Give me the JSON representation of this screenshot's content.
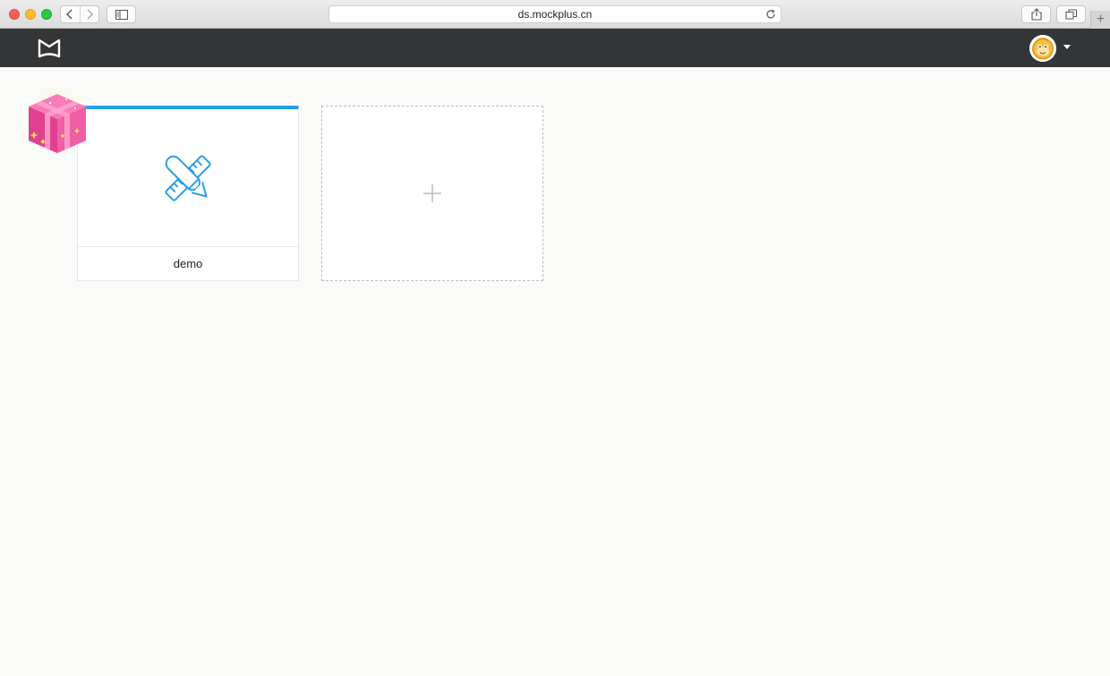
{
  "browser": {
    "url": "ds.mockplus.cn",
    "icons": {
      "back": "chevron-left-icon",
      "forward": "chevron-right-icon",
      "sidebar": "sidebar-icon",
      "reload": "reload-icon",
      "share": "share-icon",
      "tabs": "tabs-overview-icon",
      "new_tab": "plus-icon"
    },
    "new_tab_glyph": "+"
  },
  "header": {
    "logo": "mockplus-logo",
    "avatar": "monkey-avatar",
    "menu_icon": "caret-down-icon"
  },
  "projects": [
    {
      "name": "demo",
      "icon": "ruler-pencil-icon"
    }
  ],
  "add_project": {
    "icon": "plus-icon"
  },
  "promo": {
    "icon": "gift-box-icon"
  },
  "colors": {
    "header_bg": "#333537",
    "accent": "#2b9ee8",
    "content_bg": "#fafaf8"
  }
}
